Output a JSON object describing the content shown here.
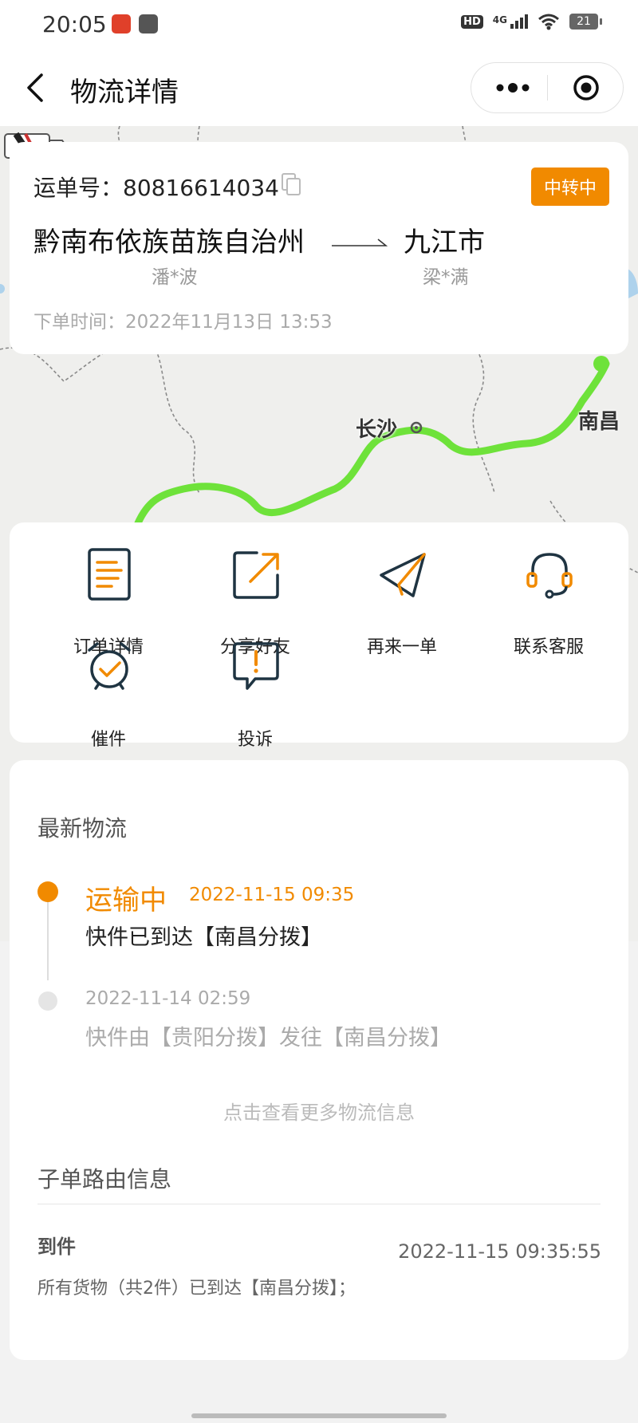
{
  "status_bar": {
    "time": "20:05",
    "network": "4G",
    "hd": "HD",
    "battery": "21"
  },
  "nav": {
    "title": "物流详情"
  },
  "map": {
    "labels": {
      "changsha": "长沙",
      "nanchang": "南昌"
    }
  },
  "order": {
    "waybill_label": "运单号：",
    "waybill_number": "80816614034",
    "status": "中转中",
    "from_city": "黔南布依族苗族自治州",
    "to_city": "九江市",
    "sender": "潘*波",
    "receiver": "梁*满",
    "order_time_label": "下单时间：",
    "order_time": "2022年11月13日 13:53"
  },
  "actions": [
    {
      "label": "订单详情",
      "icon": "document-icon"
    },
    {
      "label": "分享好友",
      "icon": "share-icon"
    },
    {
      "label": "再来一单",
      "icon": "paper-plane-icon"
    },
    {
      "label": "联系客服",
      "icon": "headset-icon"
    },
    {
      "label": "催件",
      "icon": "alarm-clock-icon"
    },
    {
      "label": "投诉",
      "icon": "complaint-icon"
    }
  ],
  "logistics": {
    "title": "最新物流",
    "events": [
      {
        "status": "运输中",
        "time": "2022-11-15 09:35",
        "desc": "快件已到达【南昌分拨】"
      },
      {
        "time": "2022-11-14 02:59",
        "desc": "快件由【贵阳分拨】发往【南昌分拨】"
      }
    ],
    "more_label": "点击查看更多物流信息"
  },
  "sub_route": {
    "title": "子单路由信息",
    "items": [
      {
        "label": "到件",
        "time": "2022-11-15 09:35:55",
        "desc": "所有货物（共2件）已到达【南昌分拨】；"
      }
    ]
  },
  "colors": {
    "accent": "#f18a00",
    "route": "#6ee23a",
    "icon_dark": "#1f3442"
  }
}
